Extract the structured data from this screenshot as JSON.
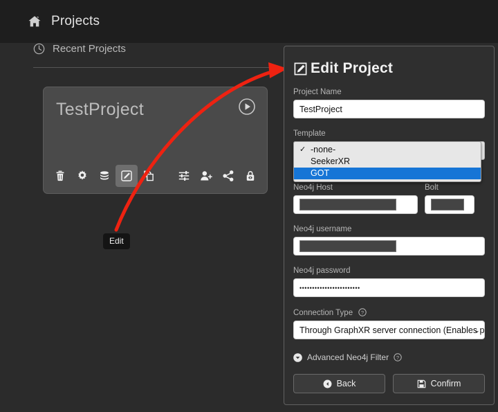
{
  "topbar": {
    "home_icon": "home-icon",
    "title": "Projects"
  },
  "left": {
    "recent_icon": "clock-icon",
    "recent_label": "Recent Projects",
    "card": {
      "project_name": "TestProject",
      "play_icon": "play-circle-icon",
      "actions": [
        {
          "name": "delete-icon",
          "label": "Delete"
        },
        {
          "name": "settings-icon",
          "label": "Settings"
        },
        {
          "name": "database-icon",
          "label": "Database"
        },
        {
          "name": "edit-icon",
          "label": "Edit"
        },
        {
          "name": "copy-icon",
          "label": "Copy"
        },
        {
          "name": "sliders-icon",
          "label": "Preferences"
        },
        {
          "name": "add-user-icon",
          "label": "Add user"
        },
        {
          "name": "share-icon",
          "label": "Share"
        },
        {
          "name": "lock-eye-icon",
          "label": "Privacy"
        }
      ]
    },
    "tooltip": "Edit"
  },
  "panel": {
    "header_icon": "pencil-square-icon",
    "header_title": "Edit Project",
    "project_name": {
      "label": "Project Name",
      "value": "TestProject"
    },
    "template": {
      "label": "Template",
      "selected": "-none-",
      "options": [
        "-none-",
        "SeekerXR",
        "GOT"
      ],
      "highlighted": "GOT",
      "open": true
    },
    "neo4j_host": {
      "label": "Neo4j Host",
      "value": "",
      "redacted": true
    },
    "bolt": {
      "label": "Bolt",
      "value": "",
      "redacted": true
    },
    "neo4j_username": {
      "label": "Neo4j username",
      "value": "",
      "redacted": true
    },
    "neo4j_password": {
      "label": "Neo4j password",
      "value": "••••••••••••••••••••••••"
    },
    "connection_type": {
      "label": "Connection Type",
      "help_icon": "question-circle-icon",
      "value": "Through GraphXR server connection (Enables project sha"
    },
    "advanced_filter": {
      "chevron_icon": "chevron-circle-down-icon",
      "label": "Advanced Neo4j Filter",
      "help_icon": "question-circle-icon"
    },
    "buttons": {
      "back": {
        "label": "Back",
        "icon": "back-circle-icon"
      },
      "confirm": {
        "label": "Confirm",
        "icon": "save-icon"
      }
    }
  },
  "annotation": {
    "arrow_color": "#ee2211"
  },
  "colors": {
    "page_bg": "#2b2b2b",
    "topbar_bg": "#1e1e1e",
    "panel_bg": "#2f2f2f",
    "card_bg": "#4a4a4a",
    "highlight_blue": "#1675d6",
    "arrow_red": "#ee2211"
  }
}
